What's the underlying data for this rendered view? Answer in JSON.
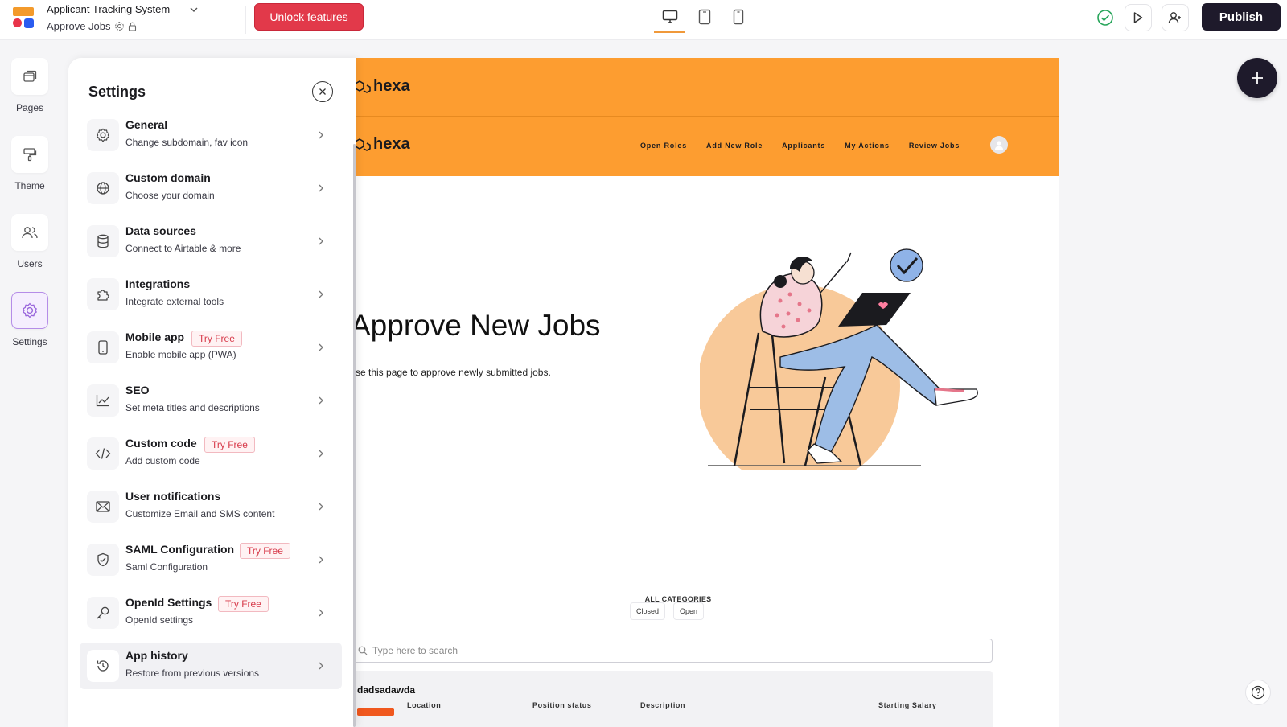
{
  "app": {
    "title": "Applicant Tracking System",
    "page_name": "Approve Jobs"
  },
  "toolbar": {
    "unlock_label": "Unlock features",
    "publish_label": "Publish",
    "devices": [
      "desktop-icon",
      "tablet-icon",
      "mobile-icon"
    ],
    "active_device": "desktop"
  },
  "rail": [
    {
      "label": "Pages",
      "icon": "pages-icon"
    },
    {
      "label": "Theme",
      "icon": "paint-roller-icon"
    },
    {
      "label": "Users",
      "icon": "users-icon"
    },
    {
      "label": "Settings",
      "icon": "gear-icon"
    }
  ],
  "settings": {
    "title": "Settings",
    "items": [
      {
        "title": "General",
        "desc": "Change subdomain, fav icon",
        "icon": "gear-icon"
      },
      {
        "title": "Custom domain",
        "desc": "Choose your domain",
        "icon": "globe-icon"
      },
      {
        "title": "Data sources",
        "desc": "Connect to Airtable & more",
        "icon": "database-icon"
      },
      {
        "title": "Integrations",
        "desc": "Integrate external tools",
        "icon": "puzzle-icon"
      },
      {
        "title": "Mobile app",
        "desc": "Enable mobile app (PWA)",
        "badge": "Try Free",
        "icon": "mobile-icon"
      },
      {
        "title": "SEO",
        "desc": "Set meta titles and descriptions",
        "icon": "chart-line-icon"
      },
      {
        "title": "Custom code",
        "desc": "Add custom code",
        "badge": "Try Free",
        "icon": "code-icon"
      },
      {
        "title": "User notifications",
        "desc": "Customize Email and SMS content",
        "icon": "mail-icon"
      },
      {
        "title": "SAML Configuration",
        "desc": "Saml Configuration",
        "badge": "Try Free",
        "icon": "shield-icon"
      },
      {
        "title": "OpenId Settings",
        "desc": "OpenId settings",
        "badge": "Try Free",
        "icon": "key-icon"
      },
      {
        "title": "App history",
        "desc": "Restore from previous versions",
        "icon": "history-icon"
      }
    ]
  },
  "preview": {
    "brand": "hexa",
    "nav": [
      "Open Roles",
      "Add New Role",
      "Applicants",
      "My Actions",
      "Review Jobs"
    ],
    "hero_title": "Approve New Jobs",
    "hero_sub": "se this page to approve newly submitted jobs.",
    "categories_label": "ALL CATEGORIES",
    "chips": [
      "Closed",
      "Open"
    ],
    "search_placeholder": "Type here to search",
    "job": {
      "title": "dadsadawda",
      "columns": [
        "Location",
        "Position status",
        "Description",
        "Starting Salary"
      ]
    }
  },
  "colors": {
    "accent_red": "#e2394a",
    "header_orange": "#fd9d30",
    "publish_dark": "#1e1a2b",
    "badge_text": "#d73a4a"
  }
}
